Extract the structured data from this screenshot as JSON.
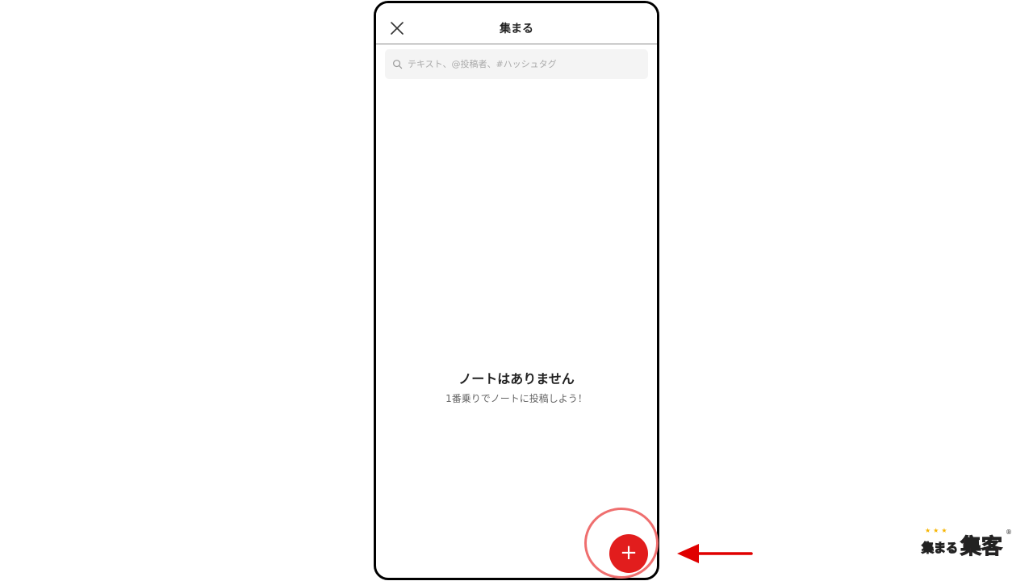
{
  "header": {
    "title": "集まる",
    "close_icon": "close-icon"
  },
  "search": {
    "placeholder": "テキスト、@投稿者、#ハッシュタグ",
    "value": "",
    "icon": "search-icon"
  },
  "empty_state": {
    "title": "ノートはありません",
    "subtitle": "1番乗りでノートに投稿しよう！"
  },
  "fab": {
    "label": "+",
    "color": "#e21d1d"
  },
  "annotation": {
    "circle_color": "#ef6f6f",
    "arrow_color": "#e00000"
  },
  "logo": {
    "stars": "★★★",
    "text_main": "集まる",
    "text_accent": "集客",
    "registered": "®"
  }
}
